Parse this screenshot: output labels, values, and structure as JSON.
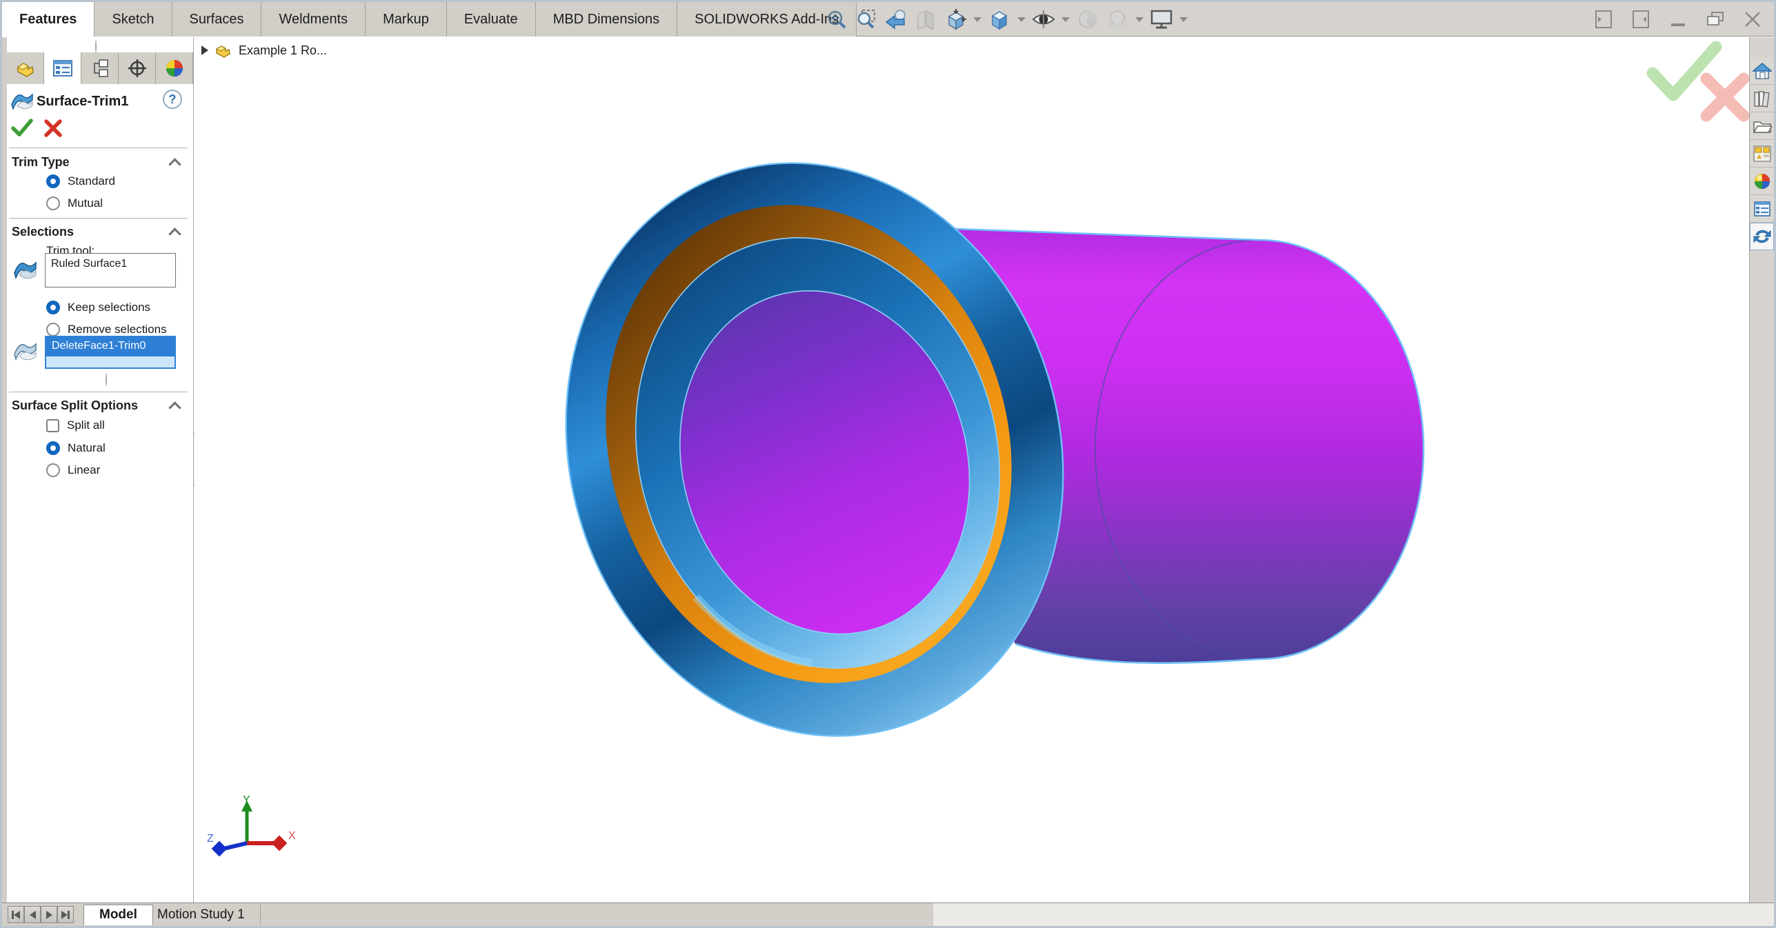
{
  "ribbon": {
    "tabs": [
      {
        "label": "Features",
        "active": true
      },
      {
        "label": "Sketch",
        "active": false
      },
      {
        "label": "Surfaces",
        "active": false
      },
      {
        "label": "Weldments",
        "active": false
      },
      {
        "label": "Markup",
        "active": false
      },
      {
        "label": "Evaluate",
        "active": false
      },
      {
        "label": "MBD Dimensions",
        "active": false
      },
      {
        "label": "SOLIDWORKS Add-Ins",
        "active": false
      }
    ]
  },
  "headsup": {
    "icons": [
      "zoom-to-fit",
      "zoom-to-area",
      "previous-view",
      "section-view",
      "view-orientation",
      "display-style",
      "hide-show-items",
      "edit-appearance",
      "apply-scene",
      "view-settings"
    ]
  },
  "window_controls": [
    "collapse-left-panel",
    "collapse-right-panel",
    "minimize",
    "restore",
    "close"
  ],
  "property_panel": {
    "tabs": [
      "feature-manager",
      "property-manager",
      "configuration-manager",
      "dimxpert-manager",
      "display-manager"
    ],
    "active_tab": "property-manager",
    "title": "Surface-Trim1",
    "help_label": "?",
    "trim_type": {
      "label": "Trim Type",
      "options": [
        {
          "label": "Standard",
          "selected": true
        },
        {
          "label": "Mutual",
          "selected": false
        }
      ]
    },
    "selections": {
      "label": "Selections",
      "trim_tool_label": "Trim tool:",
      "trim_tool_value": "Ruled Surface1",
      "options": [
        {
          "label": "Keep selections",
          "selected": true
        },
        {
          "label": "Remove selections",
          "selected": false
        }
      ],
      "selection_value": "DeleteFace1-Trim0"
    },
    "surface_split": {
      "label": "Surface Split Options",
      "split_all": {
        "label": "Split all",
        "checked": false
      },
      "options": [
        {
          "label": "Natural",
          "selected": true
        },
        {
          "label": "Linear",
          "selected": false
        }
      ]
    }
  },
  "viewport": {
    "feature_tree_node": "Example 1 Ro...",
    "triad": {
      "x": "X",
      "y": "Y",
      "z": "Z"
    }
  },
  "task_pane": {
    "icons": [
      "home",
      "design-library",
      "file-explorer",
      "view-palette",
      "appearances-scenes",
      "custom-properties",
      "sync-resources"
    ]
  },
  "status_bar": {
    "tabs": [
      {
        "label": "Model",
        "active": true
      },
      {
        "label": "Motion Study 1",
        "active": false
      }
    ]
  },
  "colors": {
    "accent_blue": "#1166c0",
    "selection_row_blue": "#2e7fd6",
    "selection_box_fill": "#cde7fa",
    "flange_blue": "#1767ae",
    "trim_orange": "#f0930f",
    "cylinder_magenta": "#c02ce4",
    "highlight_edge_blue": "#6fc0f6",
    "confirm_green": "#3f9c35",
    "cancel_red": "#d43426"
  }
}
